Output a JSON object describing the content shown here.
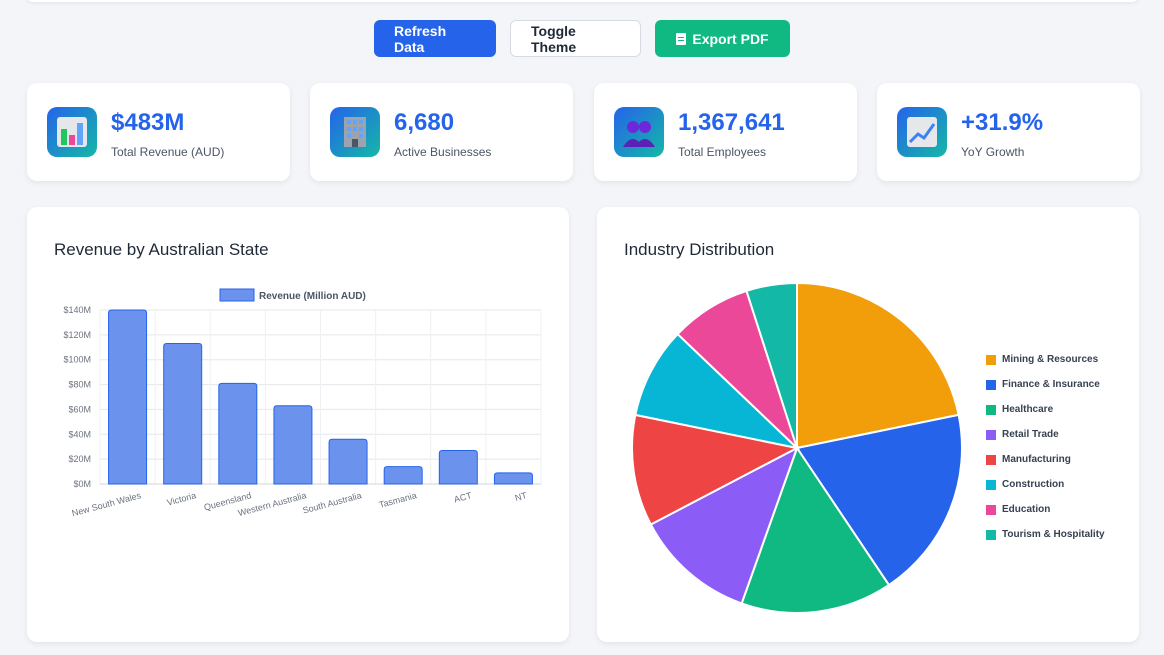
{
  "actions": {
    "refresh": "Refresh Data",
    "theme": "Toggle Theme",
    "export": "Export PDF"
  },
  "kpis": [
    {
      "value": "$483M",
      "label": "Total Revenue (AUD)",
      "icon": "bar-chart-icon"
    },
    {
      "value": "6,680",
      "label": "Active Businesses",
      "icon": "office-building-icon"
    },
    {
      "value": "1,367,641",
      "label": "Total Employees",
      "icon": "people-icon"
    },
    {
      "value": "+31.9%",
      "label": "YoY Growth",
      "icon": "trend-up-icon"
    }
  ],
  "bar_card": {
    "title": "Revenue by Australian State"
  },
  "pie_card": {
    "title": "Industry Distribution"
  },
  "chart_data": [
    {
      "type": "bar",
      "legend": "Revenue (Million AUD)",
      "categories": [
        "New South Wales",
        "Victoria",
        "Queensland",
        "Western Australia",
        "South Australia",
        "Tasmania",
        "ACT",
        "NT"
      ],
      "values": [
        140,
        113,
        81,
        63,
        36,
        14,
        27,
        9
      ],
      "ylim": [
        0,
        140
      ],
      "yticks": [
        "$0M",
        "$20M",
        "$40M",
        "$60M",
        "$80M",
        "$100M",
        "$120M",
        "$140M"
      ],
      "color": "#6b93ee",
      "grid": true,
      "legend_position": "top"
    },
    {
      "type": "pie",
      "labels": [
        "Mining & Resources",
        "Finance & Insurance",
        "Healthcare",
        "Retail Trade",
        "Manufacturing",
        "Construction",
        "Education",
        "Tourism & Hospitality"
      ],
      "values": [
        22,
        19,
        15,
        12,
        11,
        9,
        8,
        5
      ],
      "colors": [
        "#f29e0b",
        "#2563eb",
        "#10b981",
        "#8b5cf6",
        "#ef4444",
        "#06b6d4",
        "#ec4899",
        "#14b8a6"
      ],
      "legend_position": "right"
    }
  ]
}
